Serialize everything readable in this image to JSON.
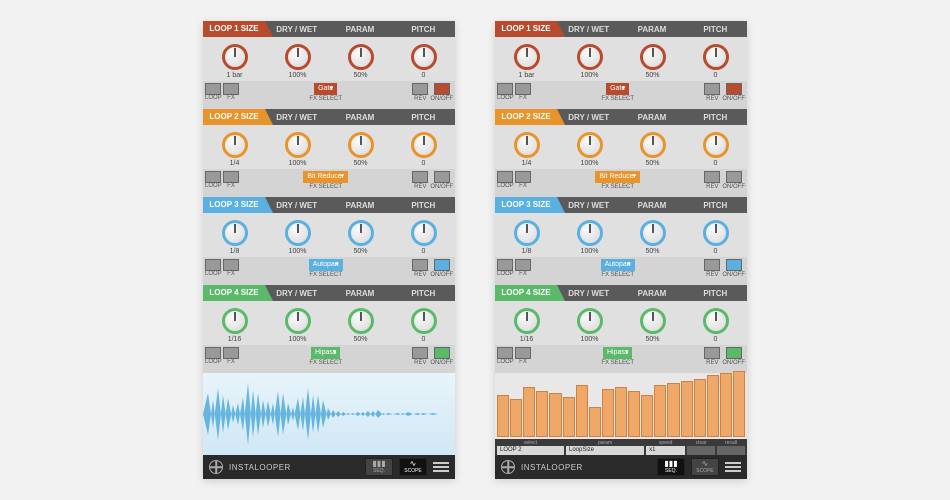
{
  "brand": "INSTALOOPER",
  "headers": {
    "dry_wet": "DRY / WET",
    "param": "PARAM",
    "pitch": "PITCH"
  },
  "labels": {
    "loop": "LOOP",
    "fx": "FX",
    "fx_select": "FX SELECT",
    "rev": "REV",
    "on_off": "ON/OFF"
  },
  "footer": {
    "seq": "SEQ.",
    "scope": "SCOPE"
  },
  "loops": [
    {
      "title": "LOOP 1 SIZE",
      "size": "1 bar",
      "dry": "100%",
      "param": "50%",
      "pitch": "0",
      "fx": "Gate"
    },
    {
      "title": "LOOP 2 SIZE",
      "size": "1/4",
      "dry": "100%",
      "param": "50%",
      "pitch": "0",
      "fx": "Bit Reducer"
    },
    {
      "title": "LOOP 3 SIZE",
      "size": "1/8",
      "dry": "100%",
      "param": "50%",
      "pitch": "0",
      "fx": "Autopan"
    },
    {
      "title": "LOOP 4 SIZE",
      "size": "1/16",
      "dry": "100%",
      "param": "50%",
      "pitch": "0",
      "fx": "Hipass"
    }
  ],
  "seq_ctrl": {
    "select_lbl": "select",
    "select_val": "LOOP 2",
    "param_lbl": "param",
    "param_val": "LoopSize",
    "speed_lbl": "speed",
    "speed_val": "x1",
    "clear_lbl": "clear",
    "recall_lbl": "recall"
  },
  "seq_heights": [
    42,
    38,
    50,
    46,
    44,
    40,
    52,
    30,
    48,
    50,
    46,
    42,
    52,
    54,
    56,
    58,
    62,
    64,
    66
  ],
  "chart_data": {
    "type": "bar",
    "title": "Step sequencer (LoopSize, LOOP 2)",
    "categories": [
      1,
      2,
      3,
      4,
      5,
      6,
      7,
      8,
      9,
      10,
      11,
      12,
      13,
      14,
      15,
      16,
      17,
      18,
      19
    ],
    "values": [
      42,
      38,
      50,
      46,
      44,
      40,
      52,
      30,
      48,
      50,
      46,
      42,
      52,
      54,
      56,
      58,
      62,
      64,
      66
    ],
    "ylim": [
      0,
      100
    ]
  }
}
